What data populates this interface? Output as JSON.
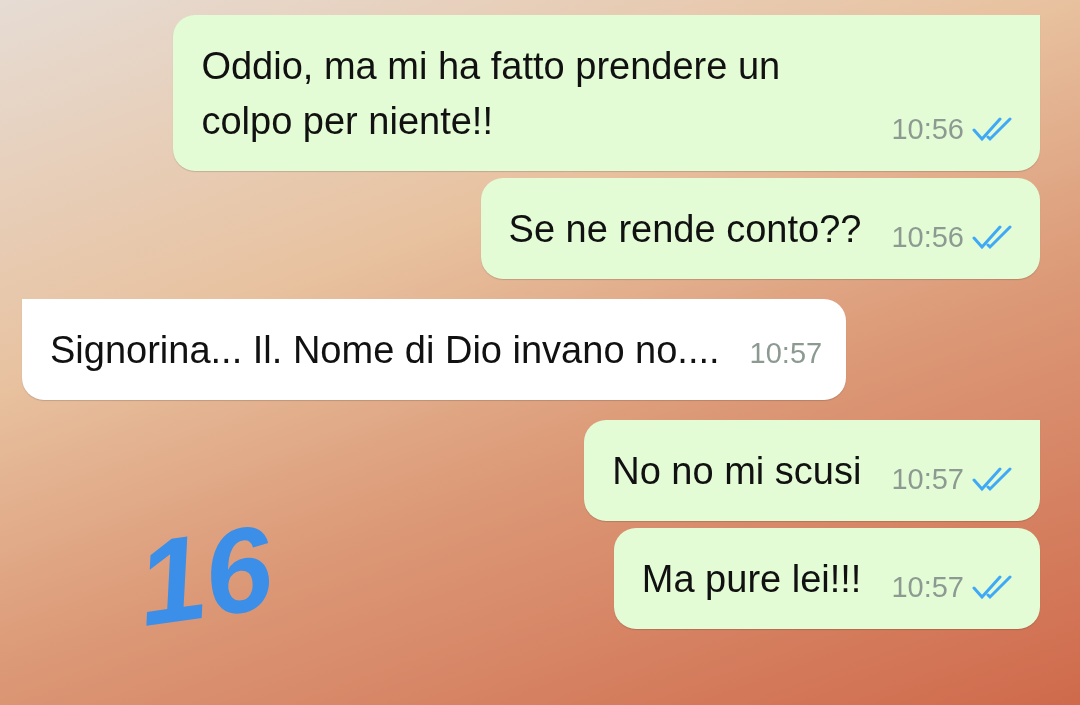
{
  "messages": [
    {
      "kind": "outgoing",
      "text": "Oddio, ma mi ha fatto prendere un colpo per niente!!",
      "time": "10:56",
      "read": true
    },
    {
      "kind": "outgoing",
      "text": "Se ne rende conto??",
      "time": "10:56",
      "read": true
    },
    {
      "kind": "incoming",
      "text": "Signorina... Il. Nome di Dio invano no....",
      "time": "10:57"
    },
    {
      "kind": "outgoing",
      "text": "No no mi scusi",
      "time": "10:57",
      "read": true
    },
    {
      "kind": "outgoing",
      "text": "Ma pure lei!!!",
      "time": "10:57",
      "read": true
    }
  ],
  "annotation": {
    "text": "16"
  }
}
